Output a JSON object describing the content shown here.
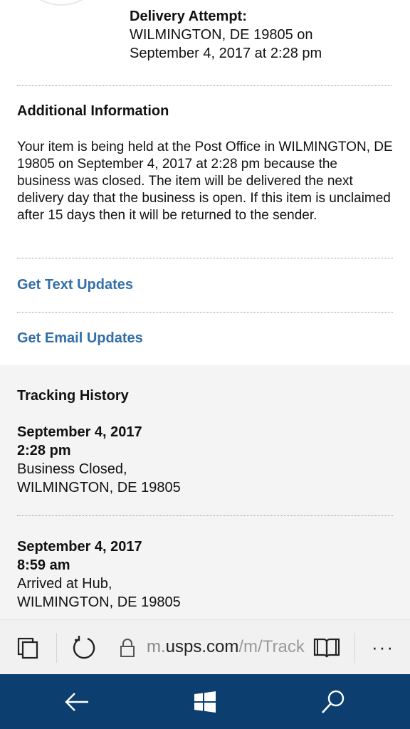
{
  "attempt": {
    "title": "Delivery Attempt:",
    "line1": "WILMINGTON, DE 19805 on",
    "line2": "September 4, 2017 at 2:28 pm"
  },
  "additional": {
    "title": "Additional Information",
    "text": "Your item is being held at the Post Office in WILMINGTON, DE 19805 on September 4, 2017 at 2:28 pm because the business was closed. The item will be delivered the next delivery day that the business is open. If this item is unclaimed after 15 days then it will be returned to the sender."
  },
  "links": {
    "text_updates": "Get Text Updates",
    "email_updates": "Get Email Updates"
  },
  "history": {
    "title": "Tracking History",
    "entries": [
      {
        "date": "September 4, 2017",
        "time": "2:28 pm",
        "status": "Business Closed,",
        "location": "WILMINGTON, DE 19805"
      },
      {
        "date": "September 4, 2017",
        "time": "8:59 am",
        "status": "Arrived at Hub,",
        "location": "WILMINGTON, DE 19805"
      }
    ]
  },
  "browser": {
    "url_prefix": "m.",
    "url_host": "usps.com",
    "url_path": "/m/Track",
    "more": "···"
  },
  "colors": {
    "link": "#336ea8",
    "taskbar": "#0c3f70",
    "status_circle": "#3b7cc9"
  },
  "icons": {
    "tabs": "tabs-icon",
    "refresh": "refresh-icon",
    "lock": "lock-icon",
    "reading": "reading-view-icon",
    "back": "back-arrow-icon",
    "windows": "windows-logo-icon",
    "search": "search-icon"
  }
}
